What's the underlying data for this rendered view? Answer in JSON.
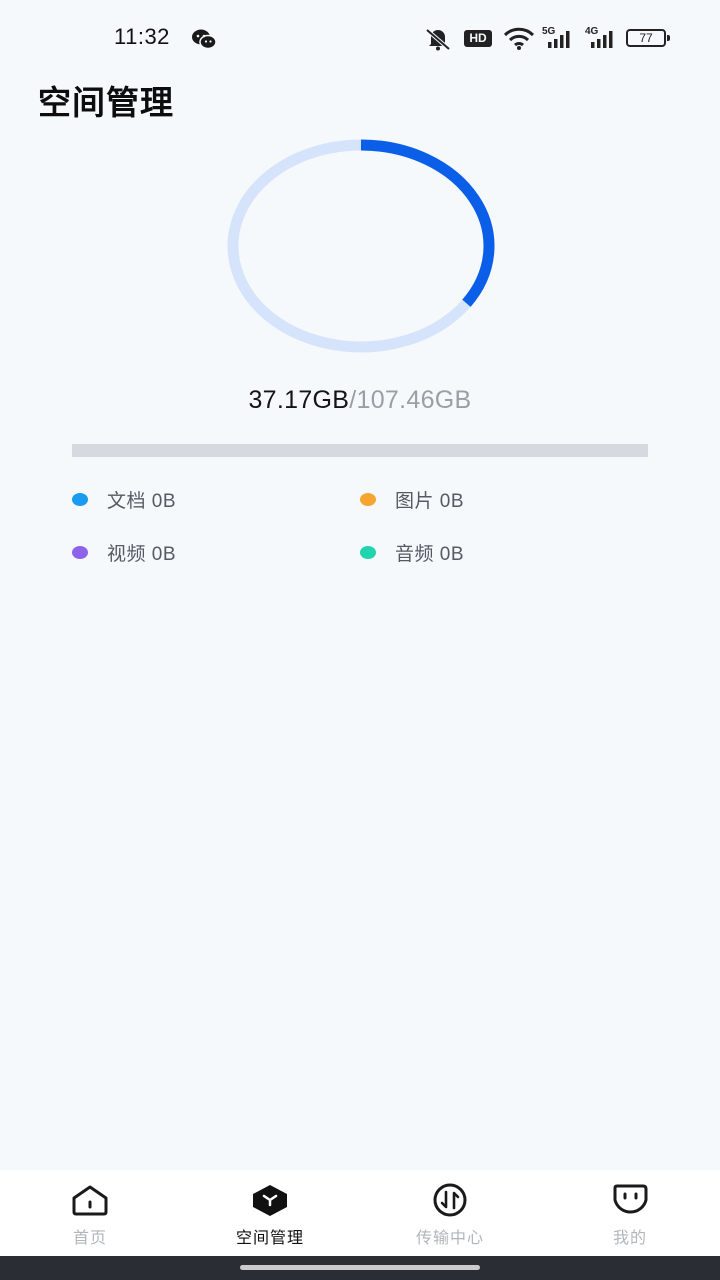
{
  "status_bar": {
    "time": "11:32",
    "icons": [
      "wechat-icon",
      "mute-bell-icon",
      "hd-icon",
      "wifi-icon",
      "5g-signal-icon",
      "4g-signal-icon"
    ],
    "hd_label": "HD",
    "net1_label": "5G",
    "net2_label": "4G",
    "battery": "77"
  },
  "page": {
    "title": "空间管理"
  },
  "storage": {
    "used": "37.17GB",
    "separator": "/",
    "total": "107.46GB",
    "used_fraction": 0.346,
    "ring_colors": {
      "track": "#d6e4fb",
      "fill": "#0a5ee8"
    }
  },
  "categories": [
    {
      "label": "文档 0B",
      "color": "#1a9bf0"
    },
    {
      "label": "图片 0B",
      "color": "#f7a531"
    },
    {
      "label": "视频 0B",
      "color": "#8d63ea"
    },
    {
      "label": "音频 0B",
      "color": "#1ed5ae"
    }
  ],
  "tabs": [
    {
      "label": "首页",
      "icon": "home-icon",
      "active": false
    },
    {
      "label": "空间管理",
      "icon": "cube-icon",
      "active": true
    },
    {
      "label": "传输中心",
      "icon": "transfer-icon",
      "active": false
    },
    {
      "label": "我的",
      "icon": "profile-face-icon",
      "active": false
    }
  ]
}
